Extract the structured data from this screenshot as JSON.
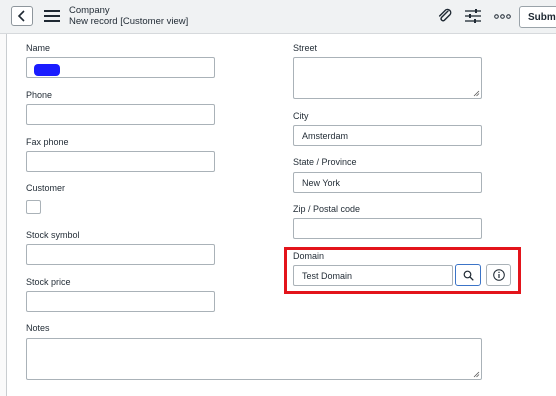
{
  "header": {
    "title": "Company",
    "subtitle": "New record [Customer view]",
    "submit_label": "Submi"
  },
  "icons": {
    "back": "chevron-left-icon",
    "menu": "hamburger-menu-icon",
    "attachment": "paperclip-icon",
    "personalize": "sliders-icon",
    "more": "more-options-icon",
    "search": "search-icon",
    "info": "info-icon"
  },
  "form": {
    "left": {
      "name_label": "Name",
      "name_value": "",
      "phone_label": "Phone",
      "phone_value": "",
      "fax_label": "Fax phone",
      "fax_value": "",
      "customer_label": "Customer",
      "customer_checked": false,
      "stock_symbol_label": "Stock symbol",
      "stock_symbol_value": "",
      "stock_price_label": "Stock price",
      "stock_price_value": ""
    },
    "right": {
      "street_label": "Street",
      "street_value": "",
      "city_label": "City",
      "city_value": "Amsterdam",
      "state_label": "State / Province",
      "state_value": "New York",
      "zip_label": "Zip / Postal code",
      "zip_value": "",
      "domain_label": "Domain",
      "domain_value": "Test Domain"
    },
    "notes_label": "Notes",
    "notes_value": ""
  },
  "colors": {
    "highlight": "#e3141b",
    "redaction": "#1a1cff",
    "search_border": "#3c74c7"
  }
}
